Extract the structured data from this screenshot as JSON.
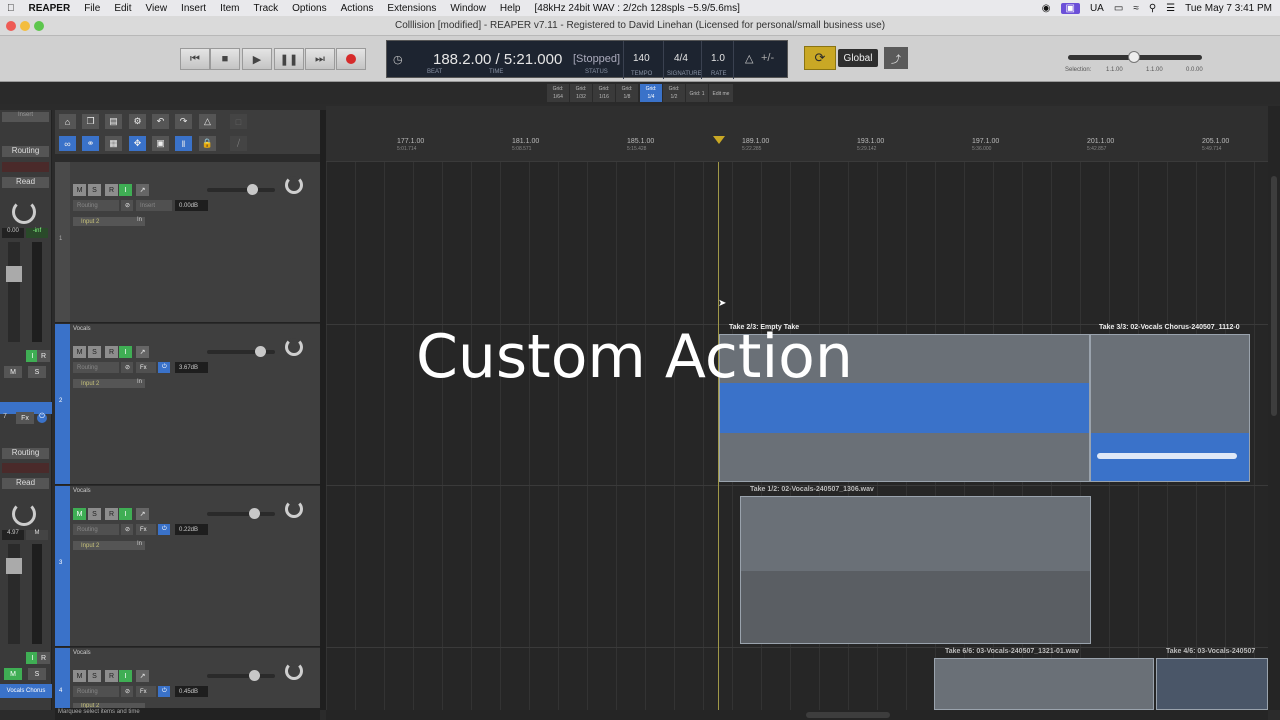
{
  "menubar": {
    "app": "REAPER",
    "items": [
      "File",
      "Edit",
      "View",
      "Insert",
      "Item",
      "Track",
      "Options",
      "Actions",
      "Extensions",
      "Window",
      "Help"
    ],
    "audio_info": "[48kHz 24bit WAV : 2/2ch 128spls ~5.9/5.6ms]",
    "ua_label": "UA",
    "clock": "Tue May 7  3:41 PM"
  },
  "window": {
    "title": "Colllision [modified] - REAPER v7.11 - Registered to David Linehan (Licensed for personal/small business use)"
  },
  "transport": {
    "position": "188.2.00 / 5:21.000",
    "state": "[Stopped]",
    "tempo": "140",
    "signature": "4/4",
    "rate": "1.0",
    "beat_label": "BEAT",
    "time_label": "TIME",
    "status_label": "STATUS",
    "tempo_label": "TEMPO",
    "signature_label": "SIGNATURE",
    "rate_label": "RATE",
    "metronome_extra": "+/-",
    "global_label": "Global",
    "selection_label": "Selection:",
    "selection_start": "1.1.00",
    "selection_end": "1.1.00",
    "selection_length": "0.0.00"
  },
  "grid": {
    "buttons": [
      {
        "top": "Grid:",
        "bottom": "1/64"
      },
      {
        "top": "Grid:",
        "bottom": "1/32"
      },
      {
        "top": "Grid:",
        "bottom": "1/16"
      },
      {
        "top": "Grid:",
        "bottom": "1/8"
      },
      {
        "top": "Grid:",
        "bottom": "1/4"
      },
      {
        "top": "Grid:",
        "bottom": "1/2"
      },
      {
        "top": "Grid: 1",
        "bottom": ""
      },
      {
        "top": "Edit me",
        "bottom": ""
      }
    ]
  },
  "mixer": {
    "insert_label": "Insert",
    "routing_1": "Routing",
    "read_1": "Read",
    "vol_1": "0.00",
    "vol_1b": "-inf",
    "routing_2": "Routing",
    "read_2": "Read",
    "vol_2": "4.97",
    "m_label": "M",
    "s_label": "S",
    "i_label": "I",
    "r_label": "R",
    "fx_label": "Fx",
    "track_num": "7",
    "bottom_name": "Vocals Chorus"
  },
  "tracks": [
    {
      "num": "1",
      "name": "",
      "vol": "0.00dB",
      "input": "Input 2",
      "in": "In"
    },
    {
      "num": "2",
      "name": "Vocals",
      "vol": "3.67dB",
      "input": "Input 2",
      "in": "In"
    },
    {
      "num": "3",
      "name": "Vocals",
      "vol": "0.22dB",
      "input": "Input 2",
      "in": "In"
    },
    {
      "num": "4",
      "name": "Vocals",
      "vol": "0.45dB",
      "input": "Input 2",
      "in": "In"
    }
  ],
  "track_buttons": {
    "m": "M",
    "s": "S",
    "r": "R",
    "i": "I",
    "routing": "Routing",
    "fx": "Fx",
    "insert": "Insert"
  },
  "ruler": {
    "marks": [
      {
        "bar": "177.1.00",
        "time": "5:01.714"
      },
      {
        "bar": "181.1.00",
        "time": "5:08.571"
      },
      {
        "bar": "185.1.00",
        "time": "5:15.428"
      },
      {
        "bar": "189.1.00",
        "time": "5:22.285"
      },
      {
        "bar": "193.1.00",
        "time": "5:29.142"
      },
      {
        "bar": "197.1.00",
        "time": "5:36.000"
      },
      {
        "bar": "201.1.00",
        "time": "5:42.857"
      },
      {
        "bar": "205.1.00",
        "time": "5:49.714"
      }
    ]
  },
  "items": {
    "take_a": "Take 2/3: Empty Take",
    "take_b": "Take 3/3: 02-Vocals Chorus-240507_1112-0",
    "take_c": "Take 1/2: 02-Vocals-240507_1306.wav",
    "take_d": "Take 6/6: 03-Vocals-240507_1321-01.wav",
    "take_e": "Take 4/6: 03-Vocals-240507"
  },
  "overlay_text": "Custom Action",
  "status_text": "Marquee select items and time",
  "colors": {
    "accent_blue": "#3a72c9",
    "loop_yellow": "#c9a825",
    "record_red": "#d62b2b",
    "arm_green": "#3fae54"
  }
}
